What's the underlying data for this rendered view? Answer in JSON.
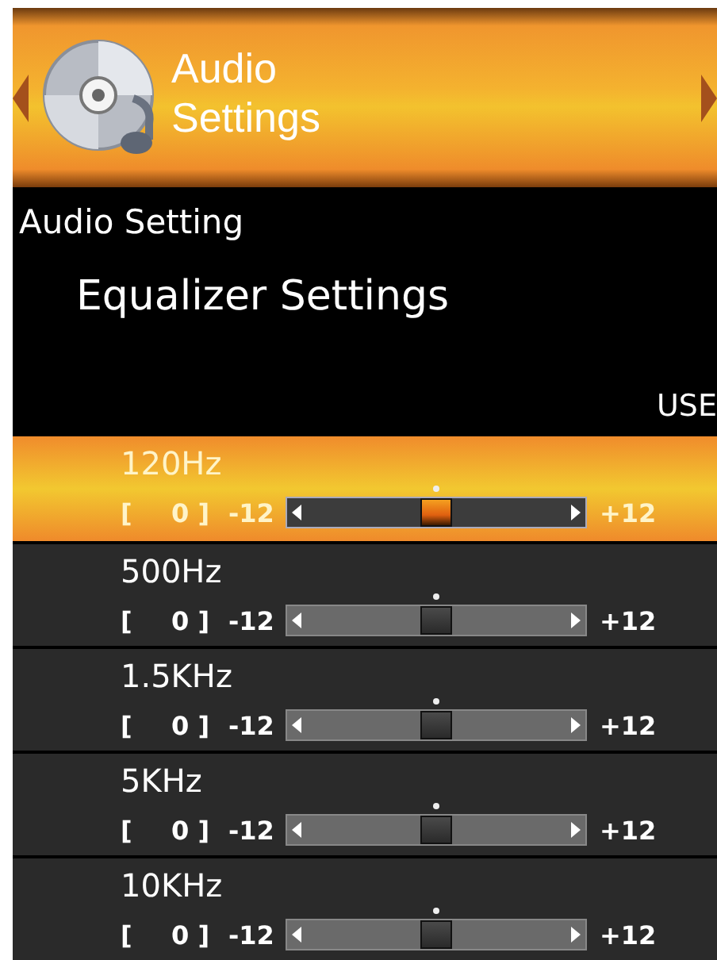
{
  "header": {
    "title_line_1": "Audio",
    "title_line_2": "Settings"
  },
  "section": {
    "label": "Audio Setting",
    "title": "Equalizer Settings",
    "mode": "USE"
  },
  "bands": [
    {
      "name": "120Hz",
      "selected": true,
      "bracket_open": "[",
      "value": "0 ]",
      "min": "-12",
      "max": "+12",
      "level": 0.5
    },
    {
      "name": "500Hz",
      "selected": false,
      "bracket_open": "[",
      "value": "0 ]",
      "min": "-12",
      "max": "+12",
      "level": 0.5
    },
    {
      "name": "1.5KHz",
      "selected": false,
      "bracket_open": "[",
      "value": "0 ]",
      "min": "-12",
      "max": "+12",
      "level": 0.5
    },
    {
      "name": "5KHz",
      "selected": false,
      "bracket_open": "[",
      "value": "0 ]",
      "min": "-12",
      "max": "+12",
      "level": 0.5
    },
    {
      "name": "10KHz",
      "selected": false,
      "bracket_open": "[",
      "value": "0 ]",
      "min": "-12",
      "max": "+12",
      "level": 0.5
    }
  ]
}
